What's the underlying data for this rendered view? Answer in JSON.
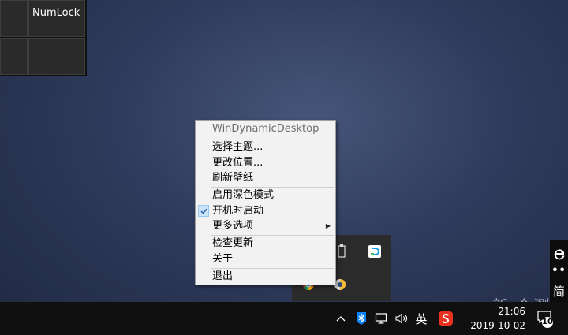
{
  "keyboard": {
    "numlock_label": "NumLock"
  },
  "context_menu": {
    "title": "WinDynamicDesktop",
    "items": [
      {
        "label": "选择主题..."
      },
      {
        "label": "更改位置..."
      },
      {
        "label": "刷新壁纸"
      },
      {
        "label": "启用深色模式"
      },
      {
        "label": "开机时启动",
        "checked": true
      },
      {
        "label": "更多选项",
        "submenu": true
      },
      {
        "label": "检查更新"
      },
      {
        "label": "关于"
      },
      {
        "label": "退出"
      }
    ]
  },
  "taskbar": {
    "language": "英",
    "time": "21:06",
    "date": "2019-10-02",
    "notification_count": "10"
  },
  "ime_widget": {
    "dots": "••",
    "mode": "简"
  },
  "watermark": "新 众测",
  "icons": {
    "checkmark": "checkmark-icon",
    "submenu_arrow": "chevron-right-icon",
    "tray_overflow": "chevron-up-icon",
    "bluetooth": "bluetooth-icon",
    "network": "network-icon",
    "volume": "volume-icon",
    "sogou": "sogou-ime-icon",
    "notifications": "action-center-icon",
    "edge": "edge-icon"
  },
  "colors": {
    "menu_bg": "#f2f2f2",
    "check_bg": "#cce4f7",
    "taskbar_bg": "#101010",
    "sogou_red": "#e8321f",
    "bluetooth_blue": "#0a84ff"
  }
}
